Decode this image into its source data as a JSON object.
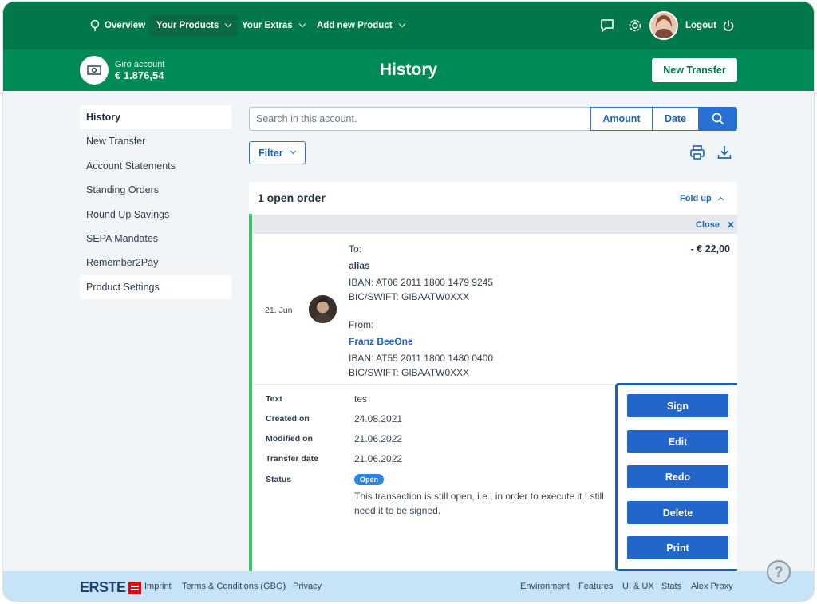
{
  "nav": {
    "overview": "Overview",
    "your_products": "Your Products",
    "your_extras": "Your Extras",
    "add_new_product": "Add new Product",
    "logout": "Logout"
  },
  "account": {
    "name": "Giro account",
    "balance": "€ 1.876,54"
  },
  "page": {
    "title": "History",
    "new_transfer": "New Transfer"
  },
  "sidebar": {
    "items": [
      {
        "label": "History"
      },
      {
        "label": "New Transfer"
      },
      {
        "label": "Account Statements"
      },
      {
        "label": "Standing Orders"
      },
      {
        "label": "Round Up Savings"
      },
      {
        "label": "SEPA Mandates"
      },
      {
        "label": "Remember2Pay"
      },
      {
        "label": "Product Settings"
      }
    ]
  },
  "search": {
    "placeholder": "Search in this account.",
    "amount": "Amount",
    "date": "Date",
    "filter": "Filter"
  },
  "order": {
    "title": "1 open order",
    "fold_up": "Fold up",
    "close": "Close",
    "date": "21. Jun",
    "amount": "- € 22,00",
    "to_label": "To:",
    "to_name": "alias",
    "to_iban": "IBAN: AT06 2011 1800 1479 9245",
    "to_bic": "BIC/SWIFT: GIBAATW0XXX",
    "from_label": "From:",
    "from_name": "Franz BeeOne",
    "from_iban": "IBAN: AT55 2011 1800 1480 0400",
    "from_bic": "BIC/SWIFT: GIBAATW0XXX"
  },
  "details": {
    "text_label": "Text",
    "text_value": "tes",
    "created_label": "Created on",
    "created_value": "24.08.2021",
    "modified_label": "Modified on",
    "modified_value": "21.06.2022",
    "transfer_label": "Transfer date",
    "transfer_value": "21.06.2022",
    "status_label": "Status",
    "status_value": "Open",
    "status_desc": "This transaction is still open, i.e., in order to execute it I still need it to be signed."
  },
  "actions": {
    "sign": "Sign",
    "edit": "Edit",
    "redo": "Redo",
    "delete": "Delete",
    "print": "Print"
  },
  "footer": {
    "brand": "ERSTE",
    "imprint": "Imprint",
    "terms": "Terms & Conditions (GBG)",
    "privacy": "Privacy",
    "environment": "Environment",
    "features": "Features",
    "ui_ux": "UI & UX",
    "stats": "Stats",
    "alex_proxy": "Alex Proxy"
  },
  "colors": {
    "brand_green": "#00784a",
    "subheader_green": "#008a55",
    "action_blue": "#2366c9",
    "status_open": "#2e86de"
  },
  "icons": [
    "location-pin-icon",
    "chat-icon",
    "gear-icon",
    "logout-power-icon",
    "banknote-icon",
    "search-icon",
    "printer-icon",
    "download-icon",
    "close-icon",
    "help-icon"
  ]
}
